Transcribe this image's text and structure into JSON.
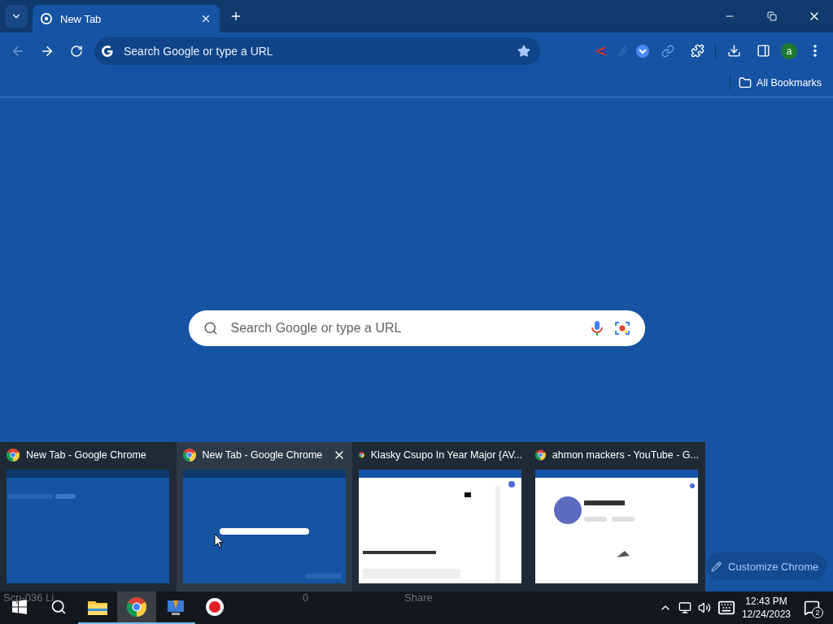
{
  "tabs": [
    {
      "title": "New Tab",
      "selected": true
    }
  ],
  "address_bar": {
    "placeholder": "Search Google or type a URL"
  },
  "bookmarks_bar": {
    "items": [
      "All Bookmarks"
    ]
  },
  "profile": {
    "initial": "a"
  },
  "search_box": {
    "placeholder": "Search Google or type a URL"
  },
  "customize_button": "Customize Chrome",
  "taskbar_previews": [
    {
      "title": "New Tab - Google Chrome",
      "hovered": false,
      "kind": "newtab"
    },
    {
      "title": "New Tab - Google Chrome",
      "hovered": true,
      "kind": "newtab-search"
    },
    {
      "title": "Klasky Csupo In Year Major {AV...",
      "hovered": false,
      "kind": "video"
    },
    {
      "title": "ahmon mackers - YouTube - G...",
      "hovered": false,
      "kind": "channel"
    }
  ],
  "taskbar": {
    "background_texts": [
      "Scp-036 Li",
      "0",
      "Share"
    ],
    "apps": [
      {
        "kind": "explorer",
        "active": false,
        "running": true
      },
      {
        "kind": "chrome",
        "active": true,
        "running": true
      },
      {
        "kind": "app",
        "active": false,
        "running": true
      },
      {
        "kind": "record",
        "active": false,
        "running": false
      }
    ],
    "clock": {
      "time": "12:43 PM",
      "date": "12/24/2023"
    },
    "notifications": "2"
  }
}
